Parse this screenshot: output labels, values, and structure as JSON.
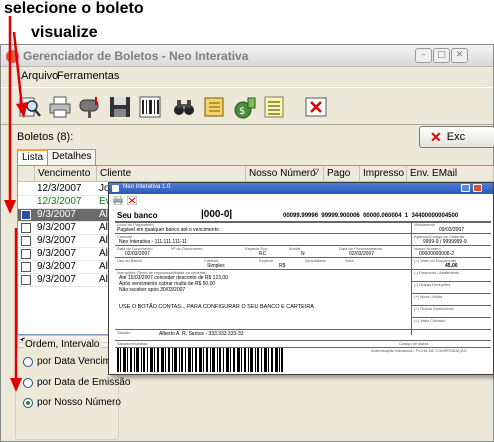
{
  "annotations": {
    "step1": "selecione o boleto",
    "step2": "visualize"
  },
  "colors": {
    "arrow": "#e00000",
    "selection": "#6a6a6a",
    "green_row": "#107c10"
  },
  "window": {
    "title": "Gerenciador de Boletos - Neo Interativa",
    "menu": [
      "Arquivo",
      "Ferramentas"
    ],
    "toolbar_icons": [
      "search-icon",
      "printer-icon",
      "mailbox-icon",
      "floppy-disk-icon",
      "barcode-sheet-icon",
      "binoculars-icon",
      "notebook-icon",
      "money-bag-icon",
      "list-icon",
      "close-icon"
    ]
  },
  "boletos": {
    "count_label": "Boletos (8):",
    "exc_button": "Exc",
    "tabs": [
      "Lista",
      "Detalhes"
    ],
    "columns": [
      "Vencimento",
      "Cliente",
      "Nosso Número",
      "Pago",
      "Impresso",
      "Env. EMail"
    ],
    "rows": [
      {
        "date": "12/3/2007",
        "client": "Joã"
      },
      {
        "date": "12/3/2007",
        "client": "Eve"
      },
      {
        "date": "9/3/2007",
        "client": "Alb"
      },
      {
        "date": "9/3/2007",
        "client": "Alb"
      },
      {
        "date": "9/3/2007",
        "client": "Alb"
      },
      {
        "date": "9/3/2007",
        "client": "Alb"
      },
      {
        "date": "9/3/2007",
        "client": "Alb"
      },
      {
        "date": "9/3/2007",
        "client": "Alb"
      }
    ]
  },
  "ordem": {
    "legend": "Ordem, Intervalo",
    "options": [
      "por Data Vencimento",
      "por Data de Emissão",
      "por Nosso Número"
    ],
    "selected": 2
  },
  "boleto_preview": {
    "title": "Neo Interativa 1.0",
    "bank": "Seu banco",
    "bank_code": "|000-0|",
    "digitable_line": "00099.99996  99999.900006  00000.060004  1  34400000004500",
    "local_pagamento_label": "Local de Pagamento",
    "local_pagamento": "Pagável em qualquer banco até o vencimento",
    "vencimento_label": "Vencimento",
    "vencimento": "09/03/2007",
    "cedente_label": "Cedente",
    "cedente": "Neo Interativa - 111.111.111-11",
    "agencia_label": "Agência/Código do Cedente",
    "agencia": "9999-9 / 9999999-9",
    "data_doc_label": "Data do Documento",
    "data_doc": "02/03/2007",
    "num_doc_label": "Nº do Documento",
    "especie_doc_label": "Espécie Doc.",
    "especie_doc": "RC",
    "aceite_label": "Aceite",
    "aceite": "N",
    "data_proc_label": "Data do Processamento",
    "data_proc": "02/03/2007",
    "nosso_numero_label": "Nosso Número",
    "nosso_numero": "00000000006-2",
    "uso_banco_label": "Uso do Banco",
    "carteira_label": "Carteira",
    "carteira": "Simples",
    "especie_label": "Espécie",
    "especie": "R$",
    "quantidade_label": "Quantidade",
    "valor_label": "Valor",
    "valor_doc_label": "(=) Valor do Documento",
    "valor_doc": "45,00",
    "instrucoes_label": "Instruções (Texto de responsabilidade do cedente)",
    "instrucoes": [
      "Até 15/03/2007 conceder desconto de R$ 123,00",
      "Após vencimento cobrar multa de R$ 50,00",
      "Não receber após 30/03/2007"
    ],
    "mensagem": "USE O BOTÃO CONTAS... PARA CONFIGURAR O SEU BANCO E CARTEIRA",
    "deducoes": [
      "(-) Desconto / Abatimento",
      "(-) Outras Deduções",
      "(+) Mora / Multa",
      "(+) Outros Acréscimos",
      "(=) Valor Cobrado"
    ],
    "sacado_label": "Sacado",
    "sacado": "Alberto A. R. Santos - 333.333.333-33",
    "sacador_label": "Sacador/Avalista",
    "codigo_baixa_label": "Código de Baixa",
    "autenticacao": "Autenticação Mecânica / FICHA DE COMPENSAÇÃO"
  }
}
